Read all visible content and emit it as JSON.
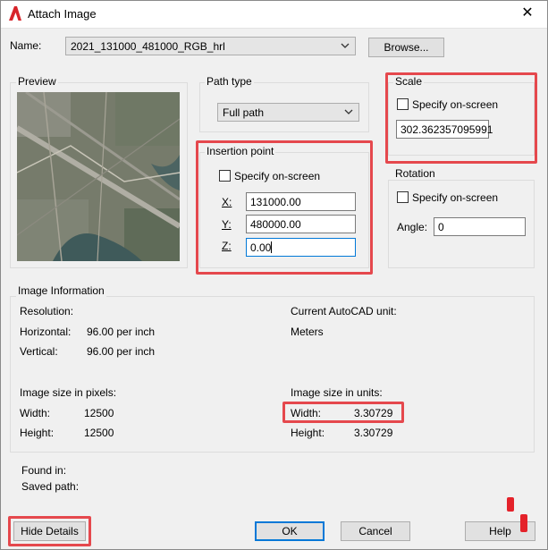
{
  "window": {
    "title": "Attach Image",
    "close_glyph": "✕",
    "app_icon": "autocad-a-icon"
  },
  "name_row": {
    "label": "Name:",
    "value": "2021_131000_481000_RGB_hrl",
    "browse_label": "Browse..."
  },
  "preview": {
    "title": "Preview"
  },
  "path_type": {
    "title": "Path type",
    "value": "Full path"
  },
  "insertion_point": {
    "title": "Insertion point",
    "specify_label": "Specify on-screen",
    "x_label": "X:",
    "x_value": "131000.00",
    "y_label": "Y:",
    "y_value": "480000.00",
    "z_label": "Z:",
    "z_value": "0.00"
  },
  "scale": {
    "title": "Scale",
    "specify_label": "Specify on-screen",
    "value": "302.362357095991"
  },
  "rotation": {
    "title": "Rotation",
    "specify_label": "Specify on-screen",
    "angle_label": "Angle:",
    "angle_value": "0"
  },
  "image_info": {
    "title": "Image Information",
    "resolution_label": "Resolution:",
    "horizontal_label": "Horizontal:",
    "horizontal_value": "96.00 per inch",
    "vertical_label": "Vertical:",
    "vertical_value": "96.00 per inch",
    "current_unit_label": "Current AutoCAD unit:",
    "current_unit_value": "Meters",
    "pixels_title": "Image size in pixels:",
    "px_width_label": "Width:",
    "px_width_value": "12500",
    "px_height_label": "Height:",
    "px_height_value": "12500",
    "units_title": "Image size in units:",
    "u_width_label": "Width:",
    "u_width_value": "3.30729",
    "u_height_label": "Height:",
    "u_height_value": "3.30729"
  },
  "found_in_label": "Found in:",
  "saved_path_label": "Saved path:",
  "buttons": {
    "hide_details": "Hide Details",
    "ok": "OK",
    "cancel": "Cancel",
    "help": "Help"
  },
  "colors": {
    "highlight": "#e5484d",
    "focus": "#0078d7",
    "dialog_bg": "#f0f0f0"
  }
}
